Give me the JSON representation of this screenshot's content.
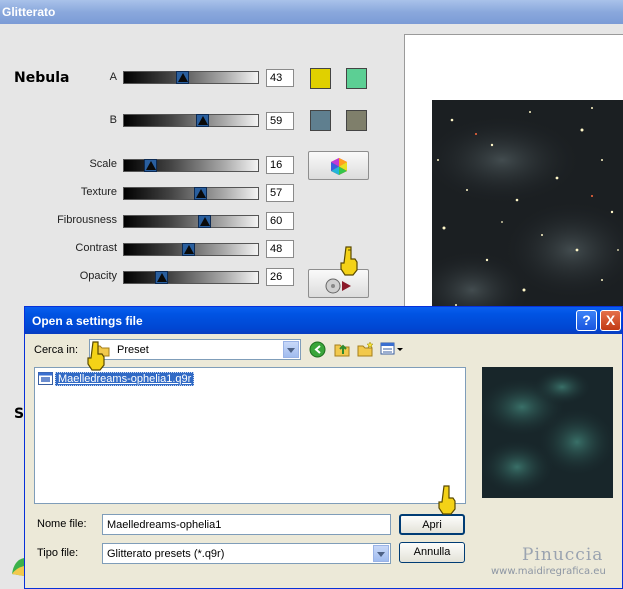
{
  "main_window": {
    "title": "Glitterato",
    "nebula_group": "Nebula",
    "partial_group": "Sc",
    "sliders": [
      {
        "label": "A",
        "value": "43",
        "position": 0.43
      },
      {
        "label": "B",
        "value": "59",
        "position": 0.59
      },
      {
        "label": "Scale",
        "value": "16",
        "position": 0.16
      },
      {
        "label": "Texture",
        "value": "57",
        "position": 0.57
      },
      {
        "label": "Fibrousness",
        "value": "60",
        "position": 0.6
      },
      {
        "label": "Contrast",
        "value": "48",
        "position": 0.48
      },
      {
        "label": "Opacity",
        "value": "26",
        "position": 0.26
      }
    ],
    "swatches": {
      "a_primary": "#e0d000",
      "a_secondary": "#5ccf94",
      "b_primary": "#5f7f8f",
      "b_secondary": "#7f7f6b"
    },
    "buttons": {
      "color_wheel_icon": "hexagon-color-wheel-icon",
      "load_preset_icon": "disc-load-icon"
    }
  },
  "dialog": {
    "title": "Open a settings file",
    "look_in_label": "Cerca in:",
    "look_in_value": "Preset",
    "files": [
      {
        "name": "Maelledreams-ophelia1.q9r",
        "selected": true
      }
    ],
    "file_name_label": "Nome file:",
    "file_name_value": "Maelledreams-ophelia1",
    "file_type_label": "Tipo file:",
    "file_type_value": "Glitterato presets (*.q9r)",
    "open_button": "Apri",
    "cancel_button": "Annulla",
    "help_button": "?",
    "close_button": "X"
  },
  "watermark": {
    "name": "Pinuccia",
    "url": "www.maidiregrafica.eu"
  }
}
